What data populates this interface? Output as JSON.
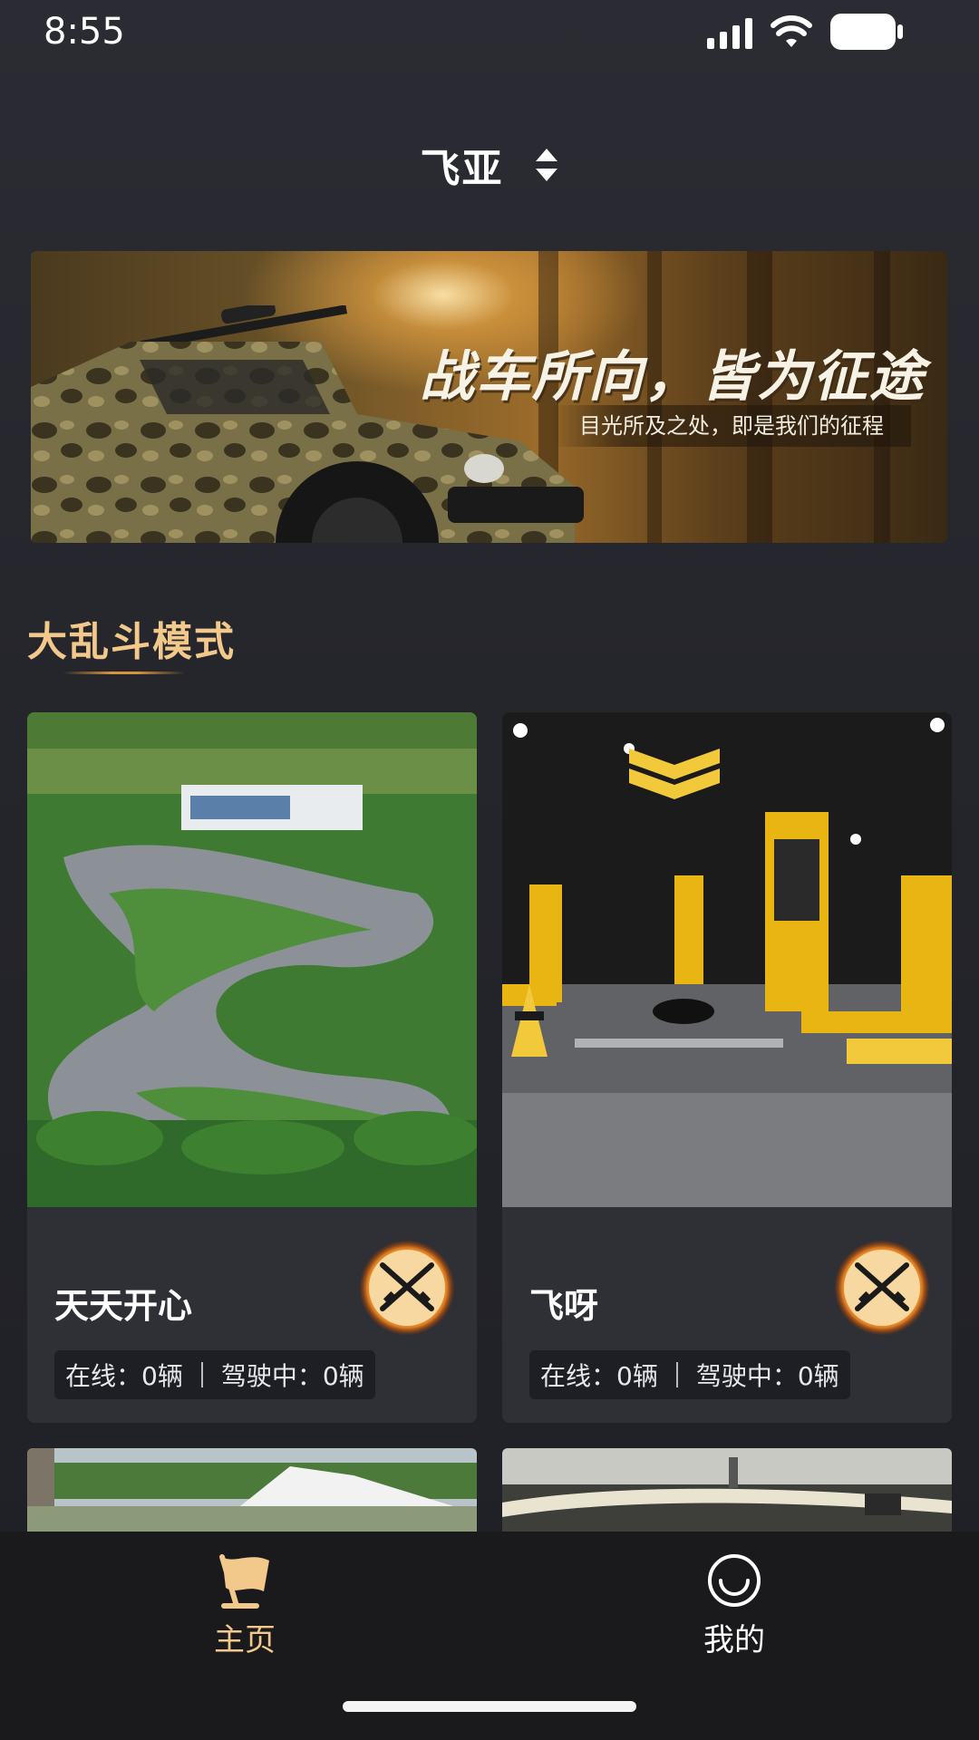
{
  "status_bar": {
    "time": "8:55",
    "icons": [
      "signal-icon",
      "wifi-icon",
      "battery-icon"
    ]
  },
  "header": {
    "title": "飞亚",
    "switch_icon": "sort-updown-icon"
  },
  "banner": {
    "headline": "战车所向，皆为征途",
    "subtitle": "目光所及之处，即是我们的征程"
  },
  "section": {
    "title": "大乱斗模式"
  },
  "venues": [
    {
      "name": "天天开心",
      "online_text": "在线：0辆",
      "driving_text": "驾驶中：0辆",
      "badge_icon": "crossed-rifles-icon"
    },
    {
      "name": "飞呀",
      "online_text": "在线：0辆",
      "driving_text": "驾驶中：0辆",
      "badge_icon": "crossed-rifles-icon"
    }
  ],
  "tabbar": {
    "items": [
      {
        "label": "主页",
        "icon": "flag-icon",
        "active": true
      },
      {
        "label": "我的",
        "icon": "smiley-icon",
        "active": false
      }
    ],
    "active_color": "#f2c98a"
  }
}
